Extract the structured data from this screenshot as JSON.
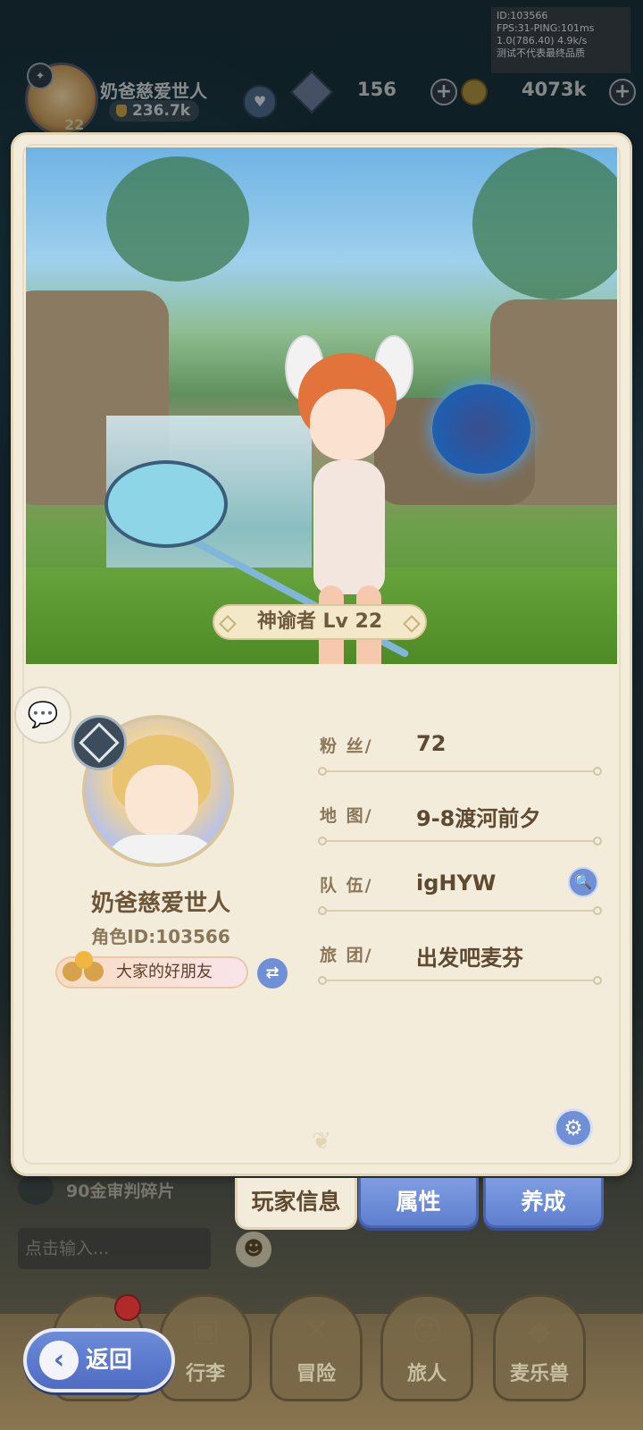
{
  "debug": {
    "line1": "ID:103566",
    "line2": "FPS:31-PING:101ms",
    "line3": "1.0(786.40) 4.9k/s",
    "line4": "测试不代表最终品质"
  },
  "topbar": {
    "player_name": "奶爸慈爱世人",
    "power": "236.7k",
    "level": "22",
    "gems": "156",
    "gold": "4073k"
  },
  "scene": {
    "class_level": "神谕者 Lv 22"
  },
  "profile": {
    "name": "奶爸慈爱世人",
    "role_id": "角色ID:103566",
    "title": "大家的好朋友",
    "fields": [
      {
        "key": "粉 丝/",
        "value": "72"
      },
      {
        "key": "地 图/",
        "value": "9-8渡河前夕"
      },
      {
        "key": "队 伍/",
        "value": "igHYW"
      },
      {
        "key": "旅 团/",
        "value": "出发吧麦芬"
      }
    ]
  },
  "tabs": [
    {
      "label": "玩家信息",
      "active": true
    },
    {
      "label": "属性",
      "active": false
    },
    {
      "label": "养成",
      "active": false
    }
  ],
  "background": {
    "task_text": "90金审判碎片",
    "chat_placeholder": "点击输入...",
    "nav": [
      "行李",
      "冒险",
      "旅人",
      "麦乐兽"
    ]
  },
  "back_button": {
    "label": "返回"
  },
  "icons": {
    "chat": "chat-bubble-icon",
    "search": "search-icon",
    "settings": "gear-icon",
    "swap": "swap-icon",
    "back": "back-arrow-icon"
  },
  "colors": {
    "panel": "#f3ecdb",
    "accent_blue": "#6f8fd6",
    "text_brown": "#5e4a31"
  }
}
